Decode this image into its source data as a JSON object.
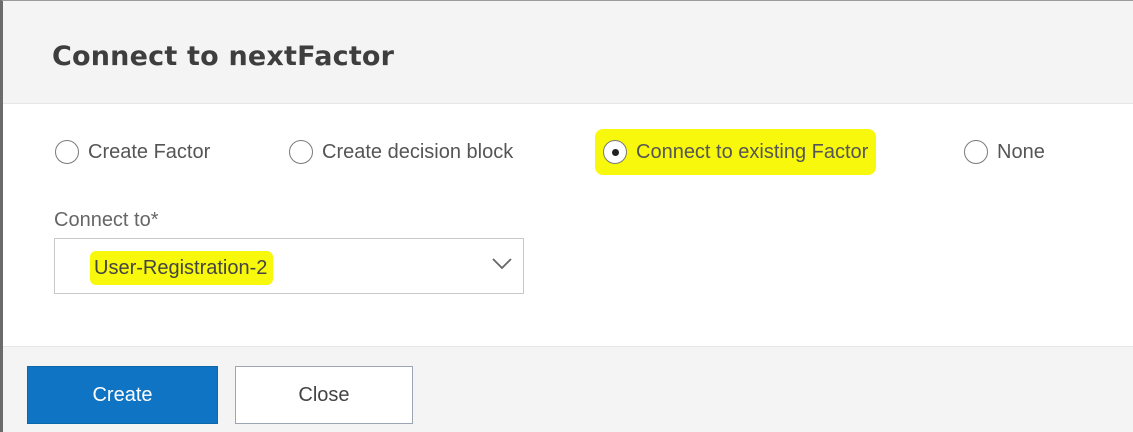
{
  "dialog": {
    "title": "Connect to nextFactor",
    "radio_options": [
      {
        "label": "Create Factor",
        "selected": false
      },
      {
        "label": "Create decision block",
        "selected": false
      },
      {
        "label": "Connect to existing Factor",
        "selected": true
      },
      {
        "label": "None",
        "selected": false
      }
    ],
    "connect_to": {
      "label": "Connect to*",
      "value": "User-Registration-2"
    },
    "buttons": {
      "create": "Create",
      "close": "Close"
    },
    "colors": {
      "primary": "#0f74c4",
      "highlight": "#f8f80c"
    },
    "icons": {
      "dropdown": "chevron-down-icon"
    }
  }
}
